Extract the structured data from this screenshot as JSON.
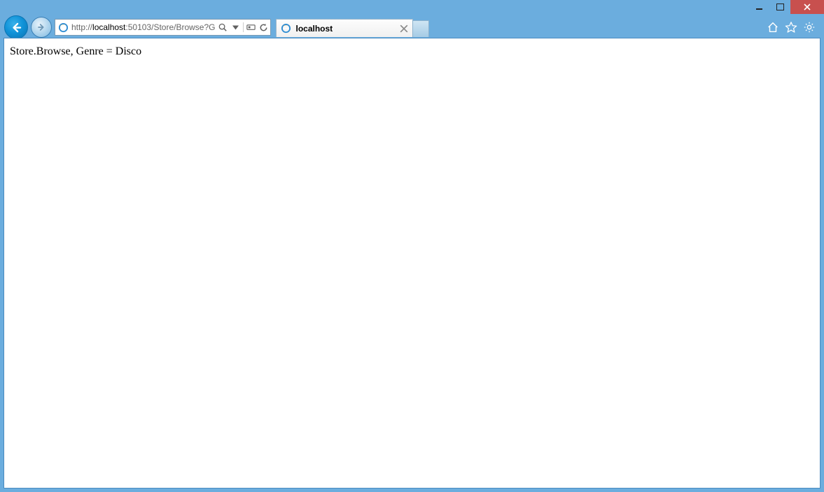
{
  "window": {
    "controls": {
      "minimize": "–",
      "maximize": "□",
      "close": "×"
    }
  },
  "toolbar": {
    "url_prefix": "http://",
    "url_host": "localhost",
    "url_rest": ":50103/Store/Browse?G",
    "tab_title": "localhost"
  },
  "page": {
    "body_text": "Store.Browse, Genre = Disco"
  }
}
